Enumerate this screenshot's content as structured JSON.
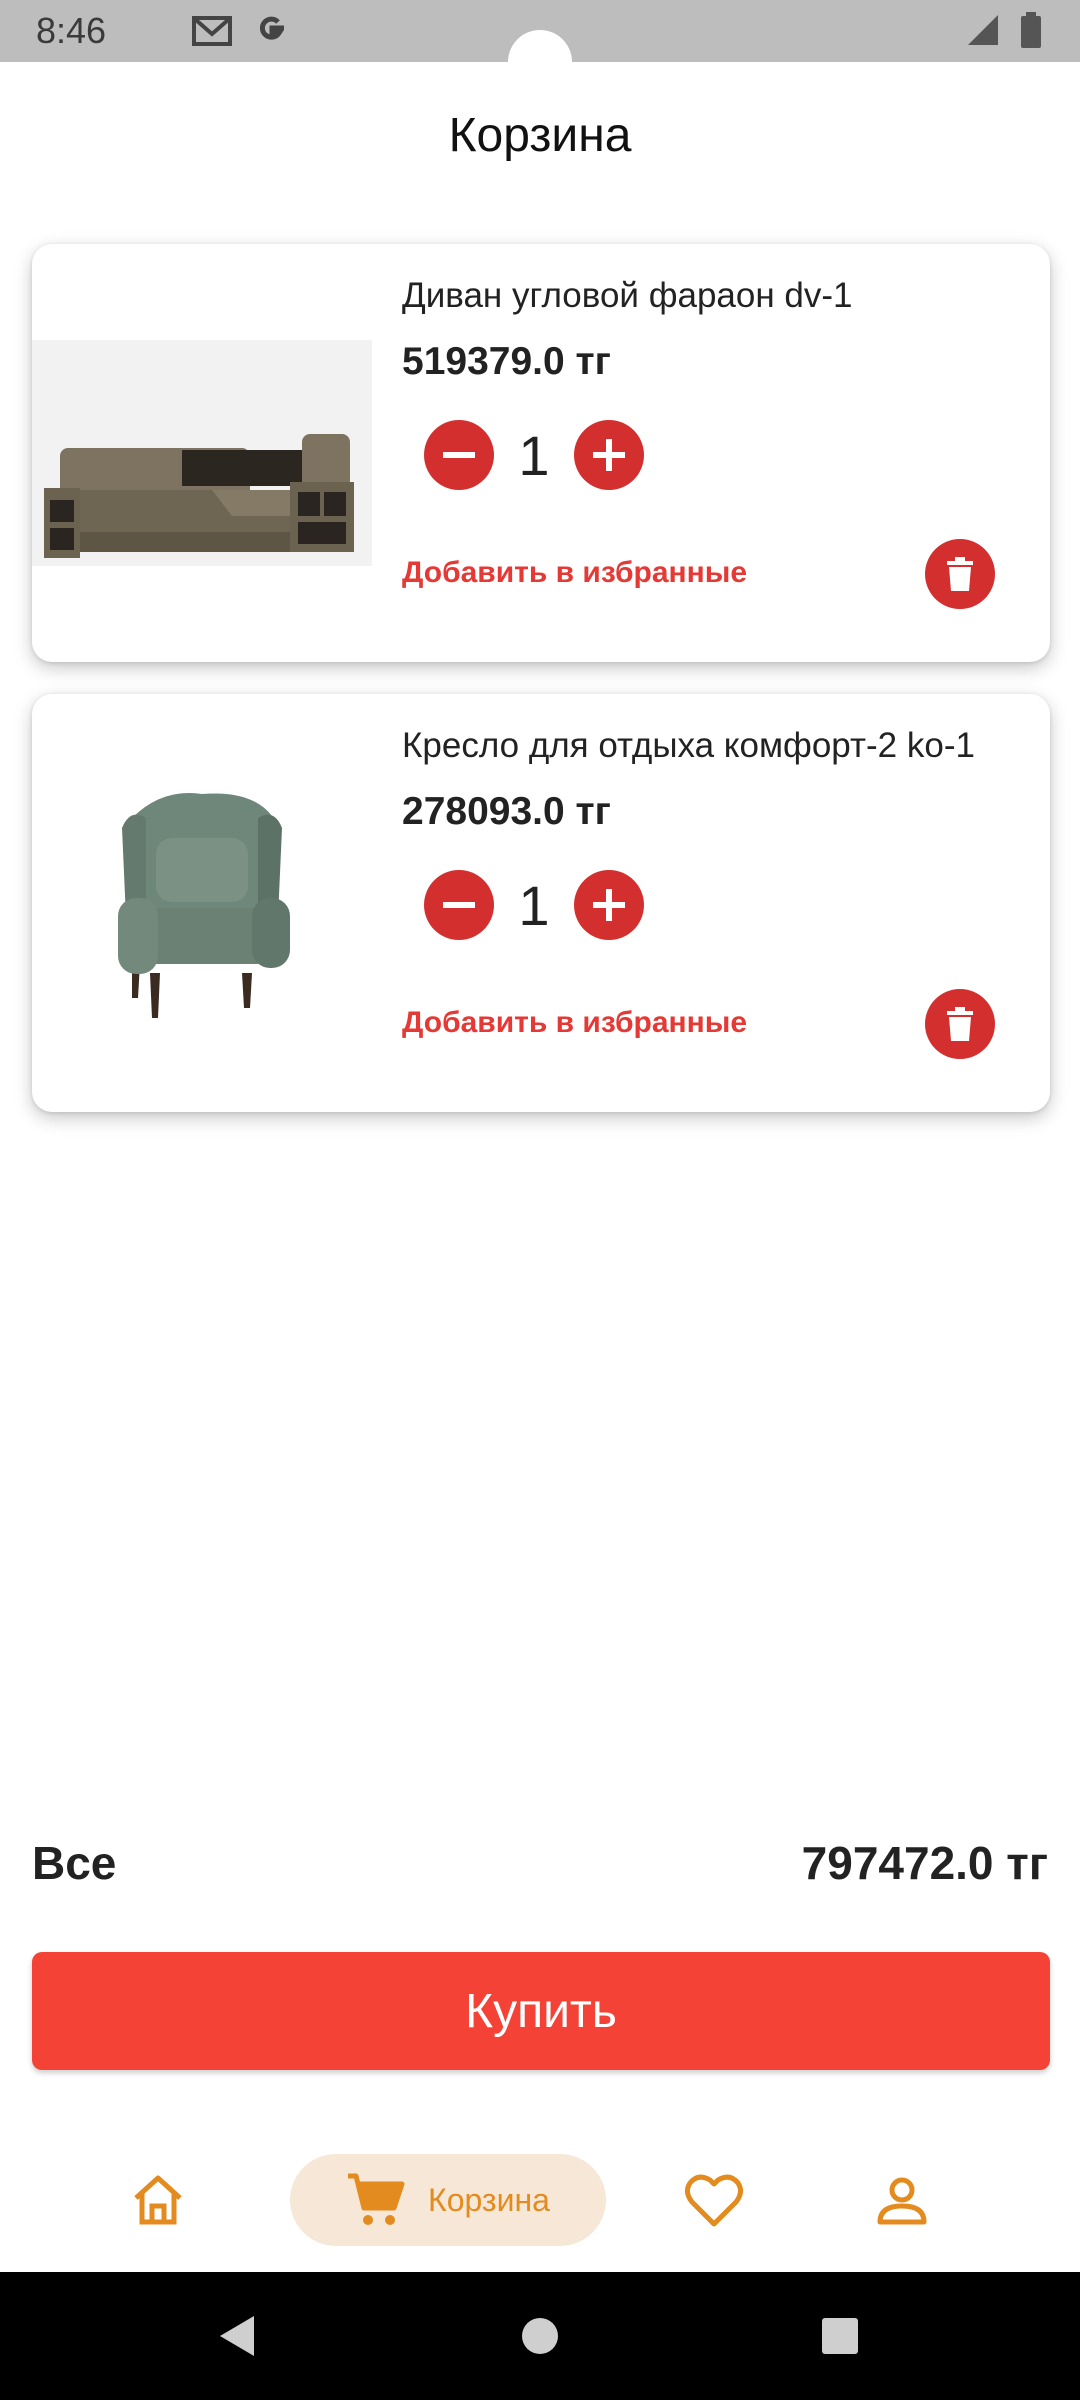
{
  "status_bar": {
    "time": "8:46",
    "icons": [
      "gmail-icon",
      "google-icon",
      "signal-icon",
      "battery-icon"
    ]
  },
  "header": {
    "title": "Корзина"
  },
  "cart": {
    "items": [
      {
        "title": "Диван угловой фараон dv-1",
        "price": "519379.0 тг",
        "quantity": "1",
        "favorite_label": "Добавить в избранные",
        "image": "corner-sofa"
      },
      {
        "title": "Кресло для отдыха комфорт-2 ko-1",
        "price": "278093.0 тг",
        "quantity": "1",
        "favorite_label": "Добавить в избранные",
        "image": "armchair"
      }
    ]
  },
  "total": {
    "label": "Все",
    "value": "797472.0 тг"
  },
  "buy_button": {
    "label": "Купить"
  },
  "bottom_nav": {
    "items": [
      {
        "icon": "home-icon",
        "active": false
      },
      {
        "icon": "cart-icon",
        "label": "Корзина",
        "active": true
      },
      {
        "icon": "heart-icon",
        "active": false
      },
      {
        "icon": "profile-icon",
        "active": false
      }
    ]
  },
  "colors": {
    "accent_red": "#d32f2f",
    "buy_red": "#f44336",
    "link_red": "#e53935",
    "nav_orange": "#e38b1f",
    "nav_active_bg": "#f7e7d6"
  }
}
